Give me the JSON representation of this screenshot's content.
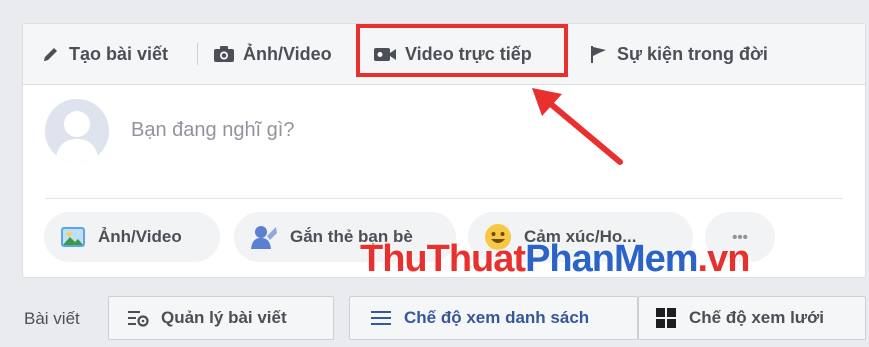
{
  "tabs": {
    "create_post": "Tạo bài viết",
    "photo_video": "Ảnh/Video",
    "live_video": "Video trực tiếp",
    "life_event": "Sự kiện trong đời"
  },
  "composer": {
    "placeholder": "Bạn đang nghĩ gì?"
  },
  "actions": {
    "photo_video": "Ảnh/Video",
    "tag_friends": "Gắn thẻ bạn bè",
    "feeling": "Cảm xúc/Ho...",
    "more": "•••"
  },
  "watermark": {
    "part1": "ThuThuat",
    "part2": "PhanMem",
    "part3": ".vn"
  },
  "bottom_bar": {
    "label": "Bài viết",
    "manage_posts": "Quản lý bài viết",
    "list_view": "Chế độ xem danh sách",
    "grid_view": "Chế độ xem lưới"
  },
  "colors": {
    "highlight": "#e8312f",
    "link_blue": "#365899",
    "watermark_red": "#e8312f",
    "watermark_blue": "#2b63c9"
  },
  "icons": [
    "pencil-icon",
    "camera-icon",
    "video-camera-icon",
    "flag-icon",
    "photo-icon",
    "tag-person-icon",
    "smiley-icon",
    "more-icon",
    "manage-gear-icon",
    "list-icon",
    "grid-icon",
    "red-arrow-icon"
  ]
}
